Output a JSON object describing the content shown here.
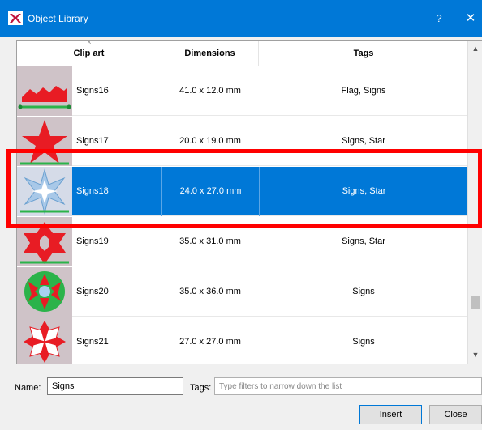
{
  "window": {
    "title": "Object Library",
    "help_label": "?",
    "close_label": "✕"
  },
  "table": {
    "columns": [
      "Clip art",
      "Dimensions",
      "Tags"
    ],
    "rows": [
      {
        "name": "Signs16",
        "dimensions": "41.0 x 12.0 mm",
        "tags": "Flag, Signs"
      },
      {
        "name": "Signs17",
        "dimensions": "20.0 x 19.0 mm",
        "tags": "Signs, Star"
      },
      {
        "name": "Signs18",
        "dimensions": "24.0 x 27.0 mm",
        "tags": "Signs, Star"
      },
      {
        "name": "Signs19",
        "dimensions": "35.0 x 31.0 mm",
        "tags": "Signs, Star"
      },
      {
        "name": "Signs20",
        "dimensions": "35.0 x 36.0 mm",
        "tags": "Signs"
      },
      {
        "name": "Signs21",
        "dimensions": "27.0 x 27.0 mm",
        "tags": "Signs"
      }
    ],
    "selected_row": "Signs18"
  },
  "filters": {
    "name_label": "Name:",
    "name_value": "Signs",
    "tags_label": "Tags:",
    "tags_value": "",
    "tags_placeholder": "Type filters to narrow down the list"
  },
  "buttons": {
    "insert": "Insert",
    "close": "Close"
  },
  "colors": {
    "title_bar": "#0078d7",
    "selection": "#0078d7",
    "highlight_box": "#ff0000"
  }
}
